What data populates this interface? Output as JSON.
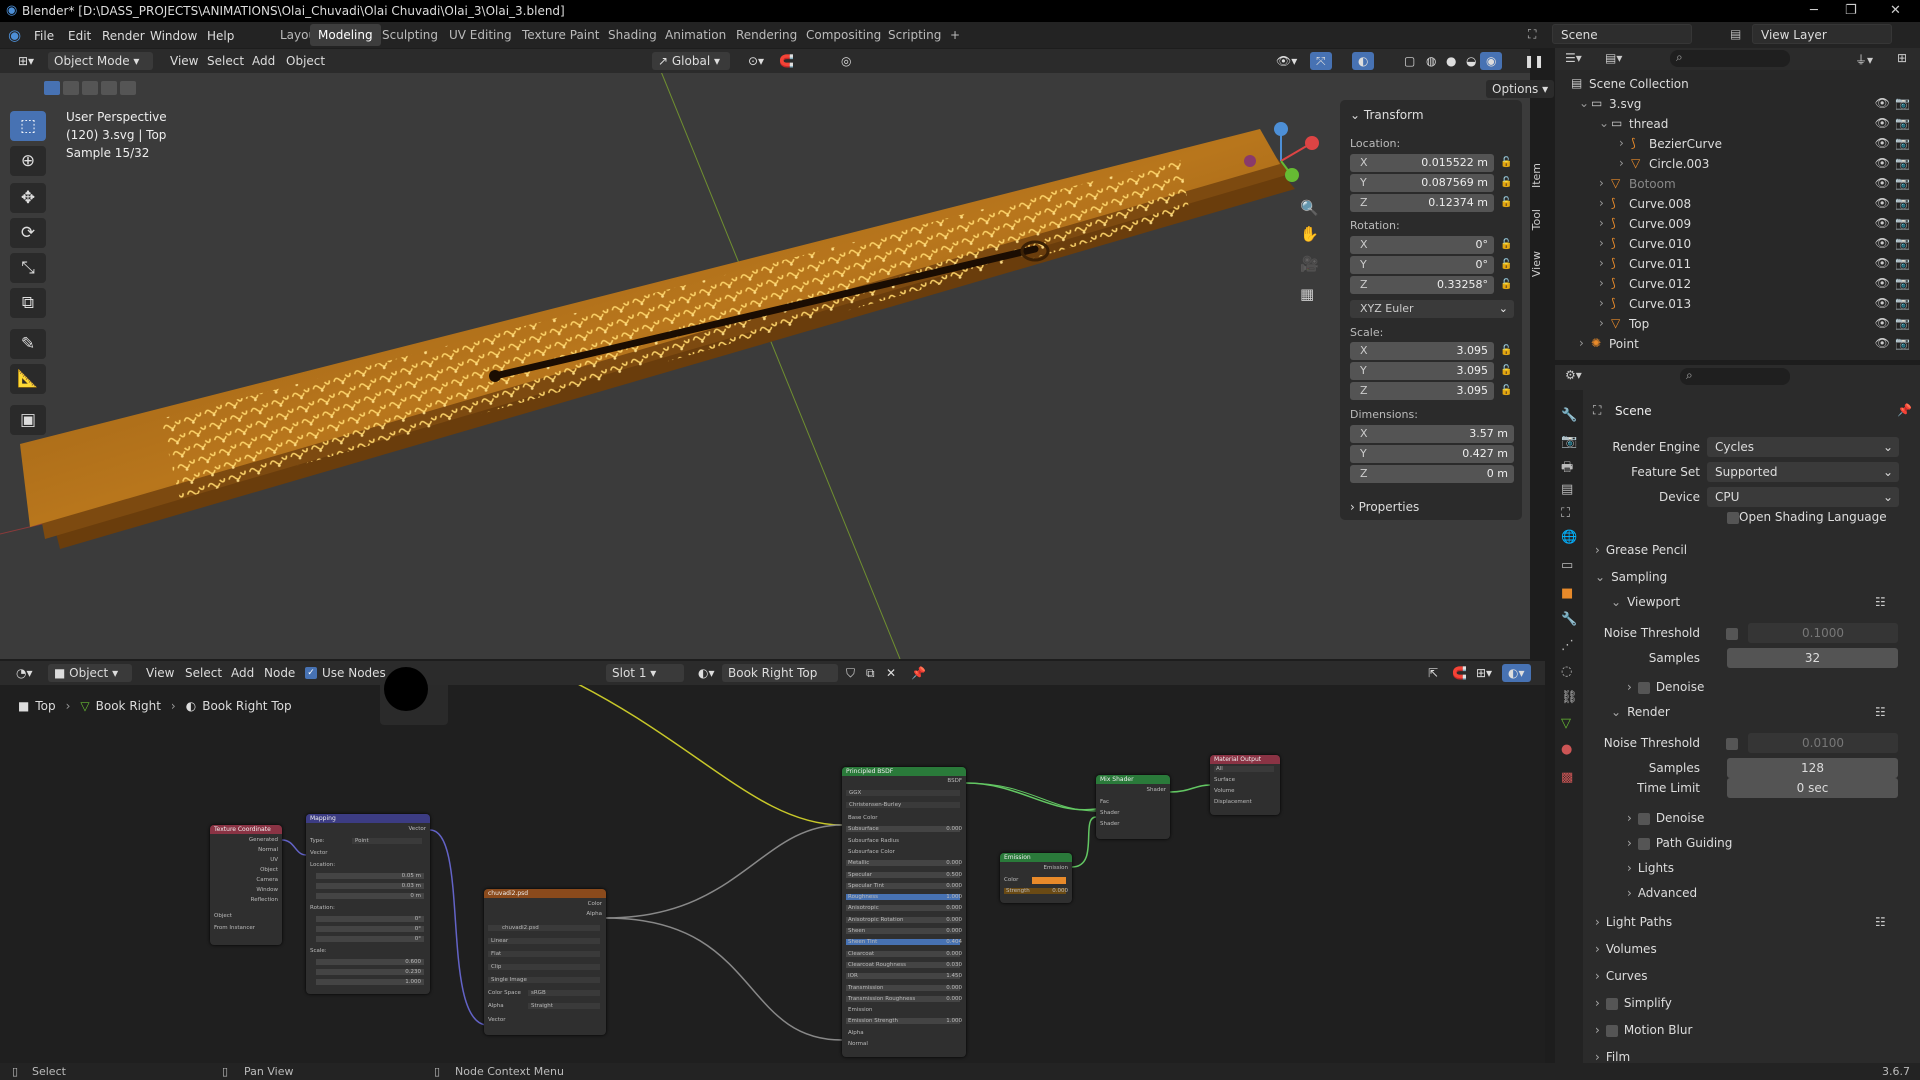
{
  "window": {
    "title": "Blender* [D:\\DASS_PROJECTS\\ANIMATIONS\\Olai_Chuvadi\\Olai Chuvadi\\Olai_3\\Olai_3.blend]"
  },
  "menus": [
    "File",
    "Edit",
    "Render",
    "Window",
    "Help"
  ],
  "workspaces": [
    "Layout",
    "Modeling",
    "Sculpting",
    "UV Editing",
    "Texture Paint",
    "Shading",
    "Animation",
    "Rendering",
    "Compositing",
    "Scripting",
    "+"
  ],
  "active_workspace": "Modeling",
  "scene": {
    "name": "Scene",
    "view_layer": "View Layer"
  },
  "viewport": {
    "mode": "Object Mode",
    "menus": [
      "View",
      "Select",
      "Add",
      "Object"
    ],
    "orientation": "Global",
    "options_label": "Options",
    "overlay_text": [
      "User Perspective",
      "(120) 3.svg | Top",
      "Sample 15/32"
    ],
    "side_tabs": [
      "Item",
      "Tool",
      "View"
    ]
  },
  "transform": {
    "header": "Transform",
    "location_label": "Location:",
    "location": {
      "x": "0.015522 m",
      "y": "0.087569 m",
      "z": "0.12374 m"
    },
    "rotation_label": "Rotation:",
    "rotation": {
      "x": "0°",
      "y": "0°",
      "z": "0.33258°"
    },
    "rotation_mode": "XYZ Euler",
    "scale_label": "Scale:",
    "scale": {
      "x": "3.095",
      "y": "3.095",
      "z": "3.095"
    },
    "dimensions_label": "Dimensions:",
    "dimensions": {
      "x": "3.57 m",
      "y": "0.427 m",
      "z": "0 m"
    },
    "properties_label": "Properties",
    "axes": {
      "x": "X",
      "y": "Y",
      "z": "Z"
    }
  },
  "outliner": {
    "items": [
      {
        "name": "Scene Collection",
        "indent": 0
      },
      {
        "name": "3.svg",
        "indent": 1
      },
      {
        "name": "thread",
        "indent": 2
      },
      {
        "name": "BezierCurve",
        "indent": 3
      },
      {
        "name": "Circle.003",
        "indent": 3
      },
      {
        "name": "Botoom",
        "indent": 2
      },
      {
        "name": "Curve.008",
        "indent": 2
      },
      {
        "name": "Curve.009",
        "indent": 2
      },
      {
        "name": "Curve.010",
        "indent": 2
      },
      {
        "name": "Curve.011",
        "indent": 2
      },
      {
        "name": "Curve.012",
        "indent": 2
      },
      {
        "name": "Curve.013",
        "indent": 2
      },
      {
        "name": "Top",
        "indent": 2
      },
      {
        "name": "Point",
        "indent": 1
      }
    ]
  },
  "properties": {
    "context": "Scene",
    "render_engine_label": "Render Engine",
    "render_engine": "Cycles",
    "feature_set_label": "Feature Set",
    "feature_set": "Supported",
    "device_label": "Device",
    "device": "CPU",
    "osl_label": "Open Shading Language",
    "sections": {
      "grease_pencil": "Grease Pencil",
      "sampling": "Sampling",
      "viewport": "Viewport",
      "denoise": "Denoise",
      "render": "Render",
      "path_guiding": "Path Guiding",
      "lights": "Lights",
      "advanced": "Advanced",
      "light_paths": "Light Paths",
      "volumes": "Volumes",
      "curves": "Curves",
      "simplify": "Simplify",
      "motion_blur": "Motion Blur",
      "film": "Film"
    },
    "noise_threshold_label": "Noise Threshold",
    "samples_label": "Samples",
    "time_limit_label": "Time Limit",
    "viewport_noise_threshold": "0.1000",
    "viewport_samples": "32",
    "render_noise_threshold": "0.0100",
    "render_samples": "128",
    "time_limit": "0 sec"
  },
  "node_editor": {
    "type": "Object",
    "menus": [
      "View",
      "Select",
      "Add",
      "Node"
    ],
    "use_nodes_label": "Use Nodes",
    "slot": "Slot 1",
    "material": "Book Right Top",
    "breadcrumb": [
      "Top",
      "Book Right",
      "Book Right Top"
    ],
    "nodes": {
      "texcoord": {
        "title": "Texture Coordinate",
        "outputs": [
          "Generated",
          "Normal",
          "UV",
          "Object",
          "Camera",
          "Window",
          "Reflection"
        ],
        "object_label": "Object",
        "from_instancer": "From Instancer"
      },
      "mapping": {
        "title": "Mapping",
        "type_label": "Type:",
        "type": "Point",
        "vector": "Vector",
        "location": "Location:",
        "rotation": "Rotation:",
        "scale": "Scale:",
        "loc_vals": [
          "0.05 m",
          "0.03 m",
          "0 m"
        ],
        "rot_vals": [
          "0°",
          "0°",
          "0°"
        ],
        "scale_vals": [
          "0.600",
          "0.230",
          "1.000"
        ]
      },
      "image": {
        "title": "chuvadi2.psd",
        "image": "chuvadi2.psd",
        "outputs": [
          "Color",
          "Alpha"
        ],
        "interp": "Linear",
        "proj": "Flat",
        "ext": "Clip",
        "source": "Single Image",
        "colorspace_label": "Color Space",
        "colorspace": "sRGB",
        "alpha_label": "Alpha",
        "alpha": "Straight",
        "vector": "Vector"
      },
      "bsdf": {
        "title": "Principled BSDF",
        "output": "BSDF",
        "distribution": "GGX",
        "sss": "Christensen-Burley",
        "rows": [
          [
            "Base Color",
            ""
          ],
          [
            "Subsurface",
            "0.000"
          ],
          [
            "Subsurface Radius",
            ""
          ],
          [
            "Subsurface Color",
            ""
          ],
          [
            "Metallic",
            "0.000"
          ],
          [
            "Specular",
            "0.500"
          ],
          [
            "Specular Tint",
            "0.000"
          ],
          [
            "Roughness",
            "1.000"
          ],
          [
            "Anisotropic",
            "0.000"
          ],
          [
            "Anisotropic Rotation",
            "0.000"
          ],
          [
            "Sheen",
            "0.000"
          ],
          [
            "Sheen Tint",
            "0.404"
          ],
          [
            "Clearcoat",
            "0.000"
          ],
          [
            "Clearcoat Roughness",
            "0.030"
          ],
          [
            "IOR",
            "1.450"
          ],
          [
            "Transmission",
            "0.000"
          ],
          [
            "Transmission Roughness",
            "0.000"
          ],
          [
            "Emission",
            ""
          ],
          [
            "Emission Strength",
            "1.000"
          ],
          [
            "Alpha",
            ""
          ],
          [
            "Normal",
            ""
          ]
        ]
      },
      "emission": {
        "title": "Emission",
        "output": "Emission",
        "color_label": "Color",
        "strength_label": "Strength",
        "strength": "0.000"
      },
      "mix": {
        "title": "Mix Shader",
        "output": "Shader",
        "inputs": [
          "Fac",
          "Shader",
          "Shader"
        ]
      },
      "output": {
        "title": "Material Output",
        "target": "All",
        "inputs": [
          "Surface",
          "Volume",
          "Displacement"
        ]
      }
    }
  },
  "status": {
    "select": "Select",
    "pan": "Pan View",
    "context": "Node Context Menu",
    "version": "3.6.7"
  },
  "colors": {
    "accent": "#4772b3",
    "wood": "#b8761c",
    "text_glow": "#ffd66b"
  }
}
